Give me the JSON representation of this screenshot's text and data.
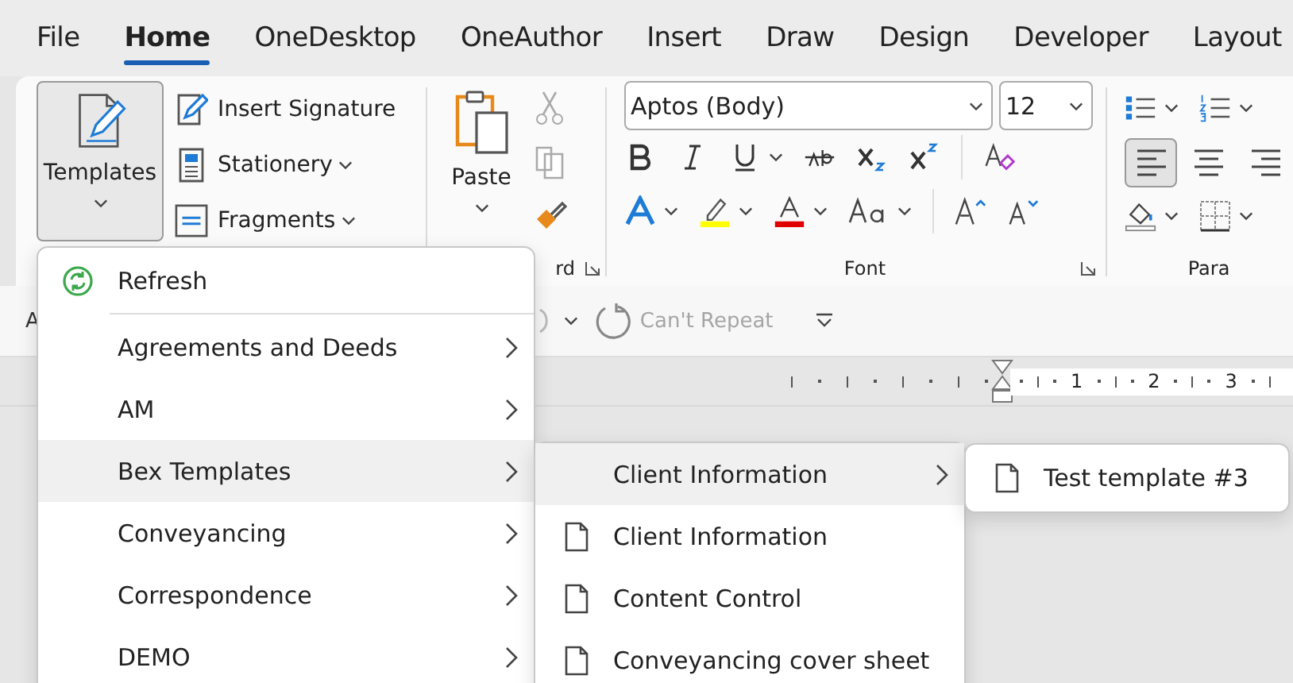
{
  "tabs": [
    {
      "label": "File",
      "selected": false
    },
    {
      "label": "Home",
      "selected": true
    },
    {
      "label": "OneDesktop",
      "selected": false
    },
    {
      "label": "OneAuthor",
      "selected": false
    },
    {
      "label": "Insert",
      "selected": false
    },
    {
      "label": "Draw",
      "selected": false
    },
    {
      "label": "Design",
      "selected": false
    },
    {
      "label": "Developer",
      "selected": false
    },
    {
      "label": "Layout",
      "selected": false
    }
  ],
  "ribbon": {
    "templates_button": {
      "label": "Templates"
    },
    "commands": [
      {
        "kind": "signature",
        "label": "Insert Signature",
        "dropdown": false
      },
      {
        "kind": "stationery",
        "label": "Stationery",
        "dropdown": true
      },
      {
        "kind": "fragments",
        "label": "Fragments",
        "dropdown": true
      }
    ],
    "clipboard": {
      "paste_label": "Paste",
      "group_label": "rd"
    },
    "font": {
      "name": "Aptos (Body)",
      "size": "12",
      "group_label": "Font"
    },
    "paragraph": {
      "group_label": "Para",
      "alignments": [
        {
          "kind": "left",
          "selected": true
        },
        {
          "kind": "center",
          "selected": false
        },
        {
          "kind": "right",
          "selected": false
        }
      ]
    }
  },
  "quick_access": {
    "fragment": "A",
    "repeat_label": "Can't Repeat",
    "repeat_disabled": true
  },
  "ruler": {
    "numbers": [
      "1",
      "2",
      "3"
    ]
  },
  "templates_menu": {
    "items": [
      {
        "kind": "action",
        "label": "Refresh",
        "selected": false
      },
      {
        "kind": "submenu",
        "label": "Agreements and Deeds",
        "selected": false
      },
      {
        "kind": "submenu",
        "label": "AM",
        "selected": false
      },
      {
        "kind": "submenu",
        "label": "Bex Templates",
        "selected": true
      },
      {
        "kind": "submenu",
        "label": "Conveyancing",
        "selected": false
      },
      {
        "kind": "submenu",
        "label": "Correspondence",
        "selected": false
      },
      {
        "kind": "submenu",
        "label": "DEMO",
        "selected": false
      }
    ]
  },
  "bex_submenu": {
    "items": [
      {
        "kind": "submenu",
        "label": "Client Information",
        "selected": true
      },
      {
        "kind": "template",
        "label": "Client Information",
        "selected": false
      },
      {
        "kind": "template",
        "label": "Content Control",
        "selected": false
      },
      {
        "kind": "template",
        "label": "Conveyancing cover sheet",
        "selected": false
      }
    ]
  },
  "client_submenu": {
    "items": [
      {
        "kind": "template",
        "label": "Test template #3",
        "selected": false
      }
    ]
  }
}
